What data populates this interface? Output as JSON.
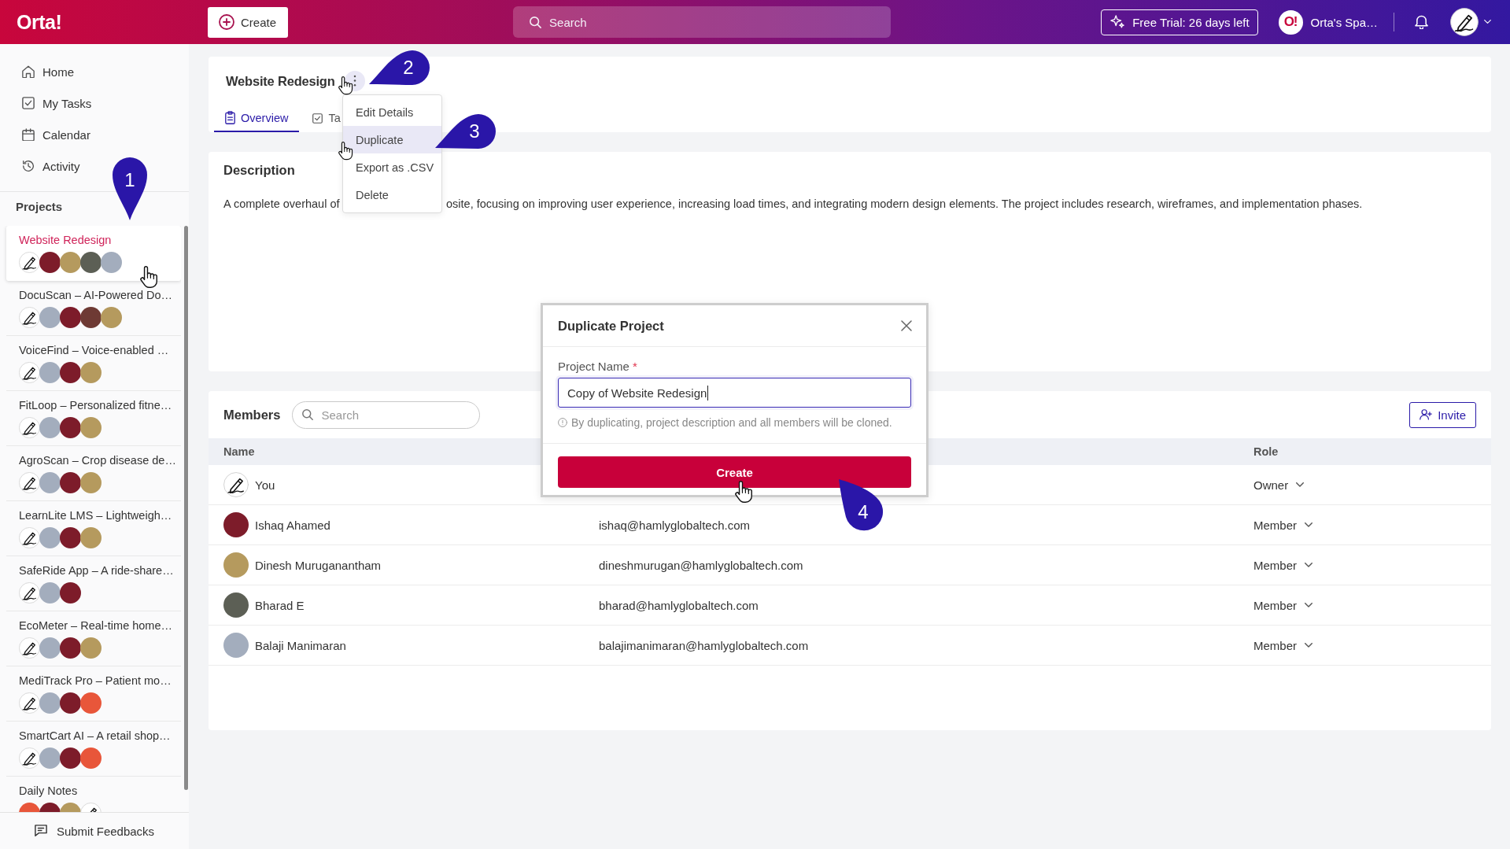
{
  "topbar": {
    "logo": "Orta!",
    "create_button": "Create",
    "search": {
      "placeholder": "Search"
    },
    "trial_button": "Free Trial: 26 days left",
    "workspace": {
      "badge": "O!",
      "name": "Orta's Spa…"
    },
    "user_avatar": {
      "kind": "pen"
    }
  },
  "sidebar": {
    "nav": [
      {
        "label": "Home",
        "selected": false
      },
      {
        "label": "My Tasks",
        "selected": false
      },
      {
        "label": "Calendar",
        "selected": false
      },
      {
        "label": "Activity",
        "selected": false
      }
    ],
    "projects_heading": "Projects",
    "projects": [
      {
        "name": "Website Redesign",
        "selected": true,
        "avatars": [
          {
            "kind": "pen"
          },
          {
            "kind": "photo",
            "color": "#7d1c2a"
          },
          {
            "kind": "photo",
            "color": "#b59a5e"
          },
          {
            "kind": "photo",
            "color": "#5c5f55"
          },
          {
            "kind": "photo",
            "color": "#a3adbd"
          }
        ]
      },
      {
        "name": "DocuScan – AI-Powered Do…",
        "selected": false,
        "avatars": [
          {
            "kind": "pen"
          },
          {
            "kind": "photo",
            "color": "#a3adbd"
          },
          {
            "kind": "photo",
            "color": "#7d1c2a"
          },
          {
            "kind": "photo",
            "color": "#6e3a34"
          },
          {
            "kind": "photo",
            "color": "#b59a5e"
          }
        ]
      },
      {
        "name": "VoiceFind – Voice-enabled …",
        "selected": false,
        "avatars": [
          {
            "kind": "pen"
          },
          {
            "kind": "photo",
            "color": "#a3adbd"
          },
          {
            "kind": "photo",
            "color": "#7d1c2a"
          },
          {
            "kind": "photo",
            "color": "#b59a5e"
          }
        ]
      },
      {
        "name": "FitLoop – Personalized fitne…",
        "selected": false,
        "avatars": [
          {
            "kind": "pen"
          },
          {
            "kind": "photo",
            "color": "#a3adbd"
          },
          {
            "kind": "photo",
            "color": "#7d1c2a"
          },
          {
            "kind": "photo",
            "color": "#b59a5e"
          }
        ]
      },
      {
        "name": "AgroScan – Crop disease de…",
        "selected": false,
        "avatars": [
          {
            "kind": "pen"
          },
          {
            "kind": "photo",
            "color": "#a3adbd"
          },
          {
            "kind": "photo",
            "color": "#7d1c2a"
          },
          {
            "kind": "photo",
            "color": "#b59a5e"
          }
        ]
      },
      {
        "name": "LearnLite LMS – Lightweigh…",
        "selected": false,
        "avatars": [
          {
            "kind": "pen"
          },
          {
            "kind": "photo",
            "color": "#a3adbd"
          },
          {
            "kind": "photo",
            "color": "#7d1c2a"
          },
          {
            "kind": "photo",
            "color": "#b59a5e"
          }
        ]
      },
      {
        "name": "SafeRide App – A ride-share…",
        "selected": false,
        "avatars": [
          {
            "kind": "pen"
          },
          {
            "kind": "photo",
            "color": "#a3adbd"
          },
          {
            "kind": "photo",
            "color": "#7d1c2a"
          }
        ]
      },
      {
        "name": "EcoMeter – Real-time home…",
        "selected": false,
        "avatars": [
          {
            "kind": "pen"
          },
          {
            "kind": "photo",
            "color": "#a3adbd"
          },
          {
            "kind": "photo",
            "color": "#7d1c2a"
          },
          {
            "kind": "photo",
            "color": "#b59a5e"
          }
        ]
      },
      {
        "name": "MediTrack Pro – Patient mo…",
        "selected": false,
        "avatars": [
          {
            "kind": "pen"
          },
          {
            "kind": "photo",
            "color": "#a3adbd"
          },
          {
            "kind": "photo",
            "color": "#7d1c2a"
          },
          {
            "kind": "photo",
            "color": "#e8563a"
          }
        ]
      },
      {
        "name": "SmartCart AI – A retail shop…",
        "selected": false,
        "avatars": [
          {
            "kind": "pen"
          },
          {
            "kind": "photo",
            "color": "#a3adbd"
          },
          {
            "kind": "photo",
            "color": "#7d1c2a"
          },
          {
            "kind": "photo",
            "color": "#e8563a"
          }
        ]
      },
      {
        "name": "Daily Notes",
        "selected": false,
        "avatars": [
          {
            "kind": "photo",
            "color": "#e8563a"
          },
          {
            "kind": "photo",
            "color": "#7d1c2a"
          },
          {
            "kind": "photo",
            "color": "#b59a5e"
          },
          {
            "kind": "pen"
          }
        ]
      }
    ],
    "footer_button": "Submit Feedbacks"
  },
  "project": {
    "title": "Website Redesign",
    "tabs": [
      {
        "label": "Overview",
        "selected": true
      },
      {
        "label": "Ta",
        "selected": false
      }
    ],
    "menu": [
      {
        "label": "Edit Details",
        "highlighted": false
      },
      {
        "label": "Duplicate",
        "highlighted": true
      },
      {
        "label": "Export as .CSV",
        "highlighted": false
      },
      {
        "label": "Delete",
        "highlighted": false
      }
    ]
  },
  "description": {
    "heading": "Description",
    "visible_text": [
      "A complete overhaul of",
      "osite, focusing on improving user experience, increasing load times, and integrating modern design elements. The project includes research, wireframes, and implementation phases."
    ]
  },
  "members": {
    "heading": "Members",
    "search": {
      "placeholder": "Search"
    },
    "invite_button": "Invite",
    "columns": [
      "Name",
      "Role"
    ],
    "rows": [
      {
        "name": "You",
        "avatar": {
          "kind": "pen"
        },
        "role": "Owner"
      },
      {
        "name": "Ishaq Ahamed",
        "avatar": {
          "kind": "photo",
          "color": "#7d1c2a"
        },
        "email": "ishaq@hamlyglobaltech.com",
        "role": "Member"
      },
      {
        "name": "Dinesh Muruganantham",
        "avatar": {
          "kind": "photo",
          "color": "#b59a5e"
        },
        "email": "dineshmurugan@hamlyglobaltech.com",
        "role": "Member"
      },
      {
        "name": "Bharad E",
        "avatar": {
          "kind": "photo",
          "color": "#5c5f55"
        },
        "email": "bharad@hamlyglobaltech.com",
        "role": "Member"
      },
      {
        "name": "Balaji Manimaran",
        "avatar": {
          "kind": "photo",
          "color": "#a3adbd"
        },
        "email": "balajimanimaran@hamlyglobaltech.com",
        "role": "Member"
      }
    ]
  },
  "dialog": {
    "title": "Duplicate Project",
    "field_label": "Project Name",
    "required_mark": "*",
    "value": "Copy of Website Redesign",
    "hint": "By duplicating, project description and all members will be cloned.",
    "submit_button": "Create"
  },
  "callouts": [
    {
      "label": "1",
      "kind": "pin-down"
    },
    {
      "label": "2",
      "kind": "pin-left"
    },
    {
      "label": "3",
      "kind": "pin-left"
    },
    {
      "label": "4",
      "kind": "pin-up-left"
    }
  ]
}
